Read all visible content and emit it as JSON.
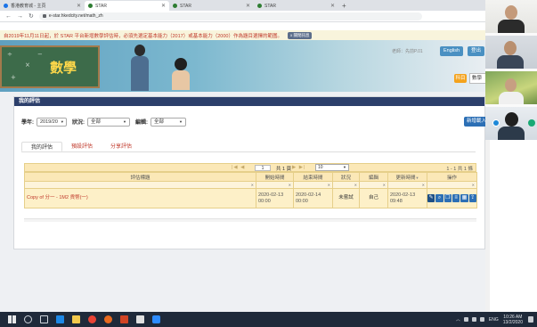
{
  "browser": {
    "tabs": [
      {
        "title": "香港教育城 - 主頁",
        "active": false
      },
      {
        "title": "STAR",
        "active": true
      },
      {
        "title": "STAR",
        "active": false
      },
      {
        "title": "STAR",
        "active": false
      }
    ],
    "new_tab": "+",
    "url": "e-star.hkedcity.net/math_zh"
  },
  "notice": {
    "text": "自2019年11月11日起，於 STAR 平台新增數學評估時，必須先選定基本能力（2017）或基本能力（2000）作為題目選擇的範圍。",
    "button": "x 關閉訊息"
  },
  "header": {
    "subject_title": "數學",
    "user_info": "老師：先前P.01",
    "lang_en": "English",
    "logout": "登出",
    "subject_badge": "科目",
    "subject_select": "數學"
  },
  "panel": {
    "title": "我的評估",
    "filters": {
      "year_label": "學年:",
      "year_value": "2019/20",
      "status_label": "狀況:",
      "status_value": "全部",
      "editor_label": "編輯:",
      "editor_value": "全部"
    },
    "new_eval_button": "新增載入評估",
    "tabs": [
      {
        "label": "我的評估",
        "active": true
      },
      {
        "label": "預設評估",
        "active": false
      },
      {
        "label": "分享評估",
        "active": false
      }
    ],
    "pager": {
      "nav_first": "|◀ ◀",
      "page": "1",
      "total": "共 1 頁",
      "nav_last": "▶ ▶|",
      "page_size": "10",
      "range": "1 - 1 共 1 條"
    },
    "table": {
      "headers": [
        "評估標題",
        "開始時間",
        "結束時間",
        "狀況",
        "編輯",
        "更新時間",
        "操作"
      ],
      "rows": [
        {
          "title": "Copy of 分一 - 1M2 貨幣(一)",
          "start": "2020-02-13 00:00",
          "end": "2020-02-14 00:00",
          "status": "未嘗試",
          "editor": "自己",
          "updated": "2020-02-13 09:48"
        }
      ],
      "op_icons": [
        "edit-icon",
        "search-icon",
        "copy-icon",
        "list-icon",
        "grid-icon",
        "share-icon"
      ]
    }
  },
  "taskbar": {
    "lang": "ENG",
    "time": "10:26 AM",
    "date": "13/2/2020"
  }
}
